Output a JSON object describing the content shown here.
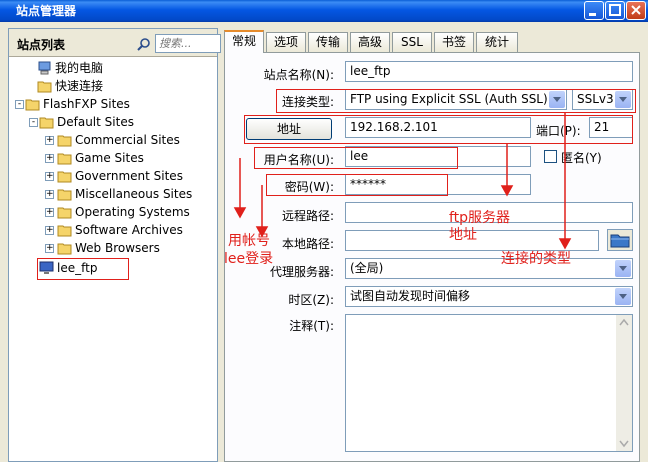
{
  "window": {
    "title": "站点管理器"
  },
  "sidebar": {
    "title": "站点列表",
    "search_placeholder": "搜索...",
    "tree": [
      {
        "label": "我的电脑",
        "icon": "computer-icon"
      },
      {
        "label": "快速连接",
        "icon": "folder-icon"
      },
      {
        "label": "FlashFXP Sites",
        "icon": "folder-icon",
        "expander": "-"
      },
      {
        "label": "Default Sites",
        "icon": "folder-icon",
        "expander": "-"
      },
      {
        "label": "Commercial Sites",
        "icon": "folder-icon",
        "expander": "+"
      },
      {
        "label": "Game Sites",
        "icon": "folder-icon",
        "expander": "+"
      },
      {
        "label": "Government Sites",
        "icon": "folder-icon",
        "expander": "+"
      },
      {
        "label": "Miscellaneous Sites",
        "icon": "folder-icon",
        "expander": "+"
      },
      {
        "label": "Operating Systems",
        "icon": "folder-icon",
        "expander": "+"
      },
      {
        "label": "Software Archives",
        "icon": "folder-icon",
        "expander": "+"
      },
      {
        "label": "Web Browsers",
        "icon": "folder-icon",
        "expander": "+"
      },
      {
        "label": "lee_ftp",
        "icon": "monitor-icon"
      }
    ]
  },
  "tabs": [
    "常规",
    "选项",
    "传输",
    "高级",
    "SSL",
    "书签",
    "统计"
  ],
  "form": {
    "site_name_label": "站点名称(N):",
    "site_name": "lee_ftp",
    "conn_type_label": "连接类型:",
    "conn_type": "FTP using Explicit SSL (Auth SSL)",
    "ssl_version": "SSLv3",
    "address_button": "地址",
    "address": "192.168.2.101",
    "port_label": "端口(P):",
    "port": "21",
    "username_label": "用户名称(U):",
    "username": "lee",
    "anonymous_label": "匿名(Y)",
    "password_label": "密码(W):",
    "password": "******",
    "remote_path_label": "远程路径:",
    "remote_path": "",
    "local_path_label": "本地路径:",
    "local_path": "",
    "proxy_label": "代理服务器:",
    "proxy": "(全局)",
    "timezone_label": "时区(Z):",
    "timezone": "试图自动发现时间偏移",
    "notes_label": "注释(T):",
    "notes": ""
  },
  "annotations": {
    "login": [
      "用帐号",
      "lee登录"
    ],
    "server": [
      "ftp服务器",
      "地址"
    ],
    "conn_type": "连接的类型"
  },
  "colors": {
    "annotation": "#e0201b",
    "titlebar": "#0454e2"
  }
}
